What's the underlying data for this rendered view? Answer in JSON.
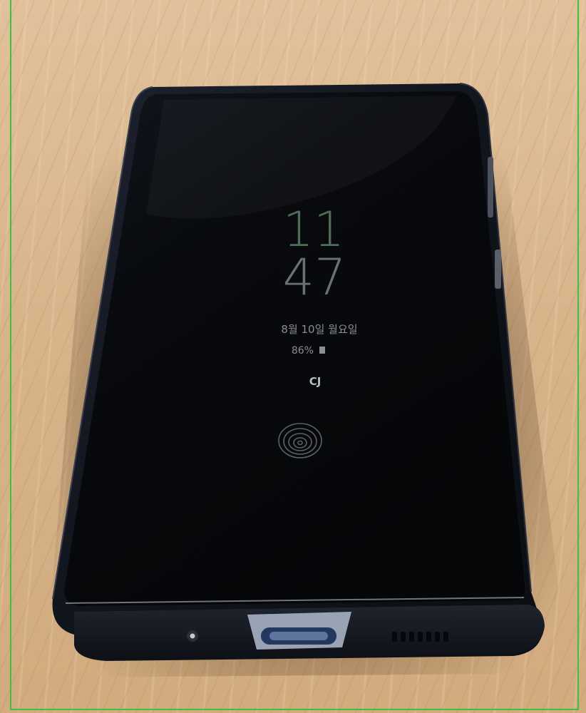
{
  "aod": {
    "clock_hour": "11",
    "clock_minute": "47",
    "date_text": "8월 10일 월요일",
    "battery_text": "86%",
    "notification_icon_text": "CJ"
  },
  "colors": {
    "table": "#d9b58c",
    "phone_body": "#141820",
    "screen": "#07090d",
    "clock_hour": "#4f6d58",
    "clock_minute": "#6b6f78",
    "aod_text": "#8a8d94",
    "frame_border": "#3ec23e"
  },
  "icons": {
    "fingerprint": "fingerprint-icon",
    "battery": "battery-icon",
    "camera": "front-camera-icon",
    "usb": "usb-c-port-icon",
    "speaker": "speaker-grille-icon"
  }
}
